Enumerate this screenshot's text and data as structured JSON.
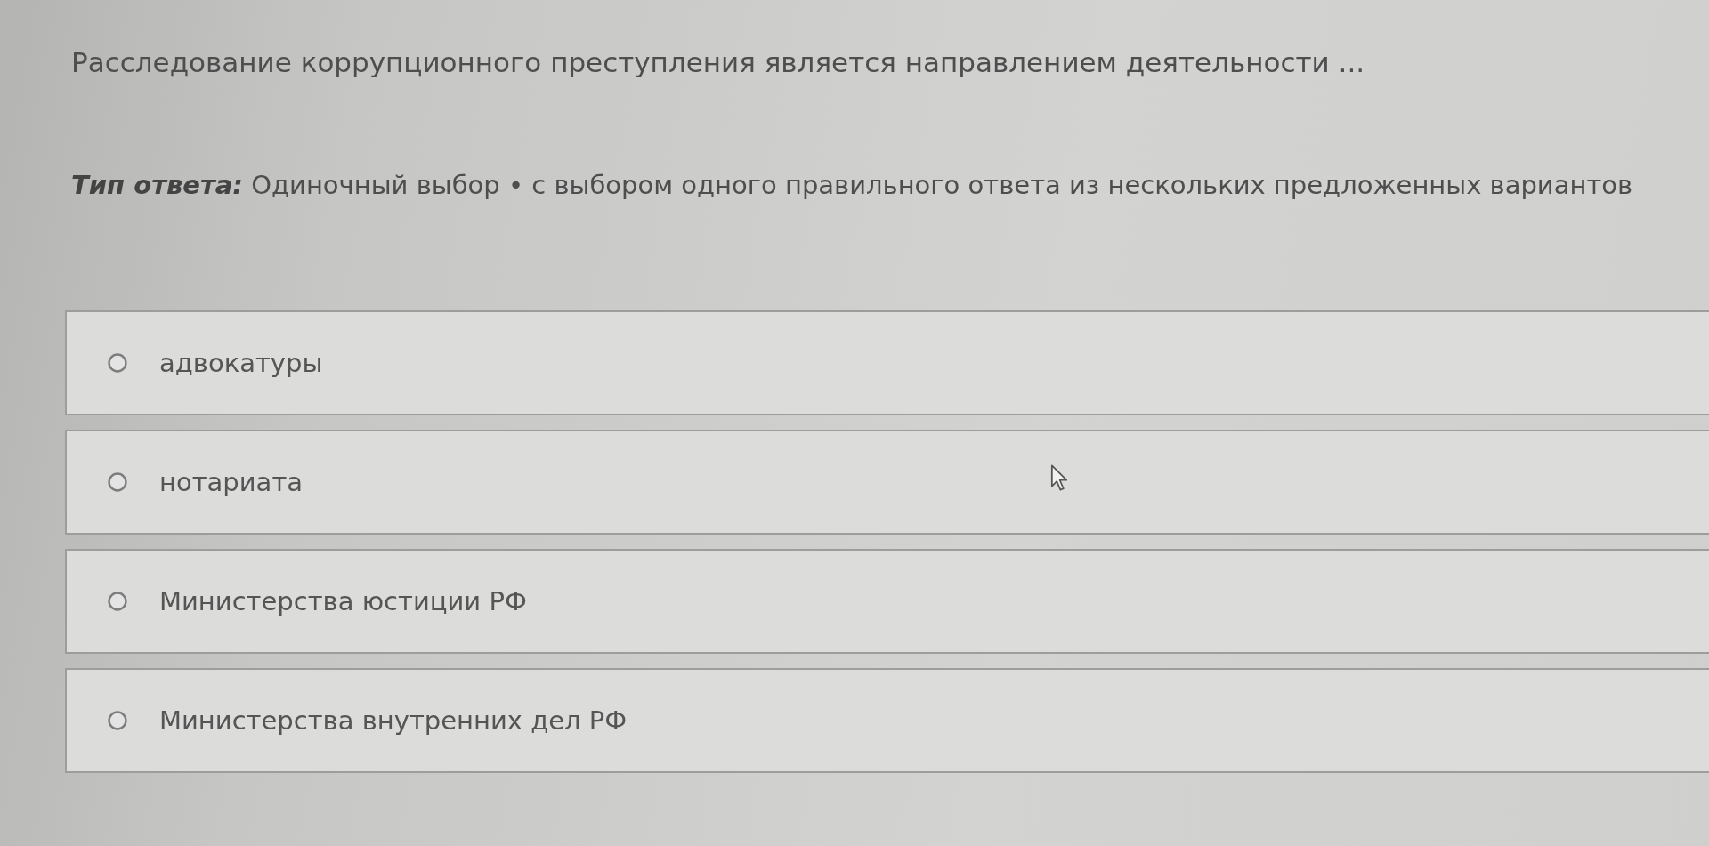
{
  "question": {
    "text": "Расследование коррупционного преступления является направлением деятельности ..."
  },
  "answer_type": {
    "label": "Тип ответа:",
    "value": "Одиночный выбор • с выбором одного правильного ответа из нескольких предложенных вариантов"
  },
  "options": [
    {
      "label": "адвокатуры",
      "selected": false
    },
    {
      "label": "нотариата",
      "selected": false
    },
    {
      "label": "Министерства юстиции РФ",
      "selected": false
    },
    {
      "label": "Министерства внутренних дел РФ",
      "selected": false
    }
  ]
}
